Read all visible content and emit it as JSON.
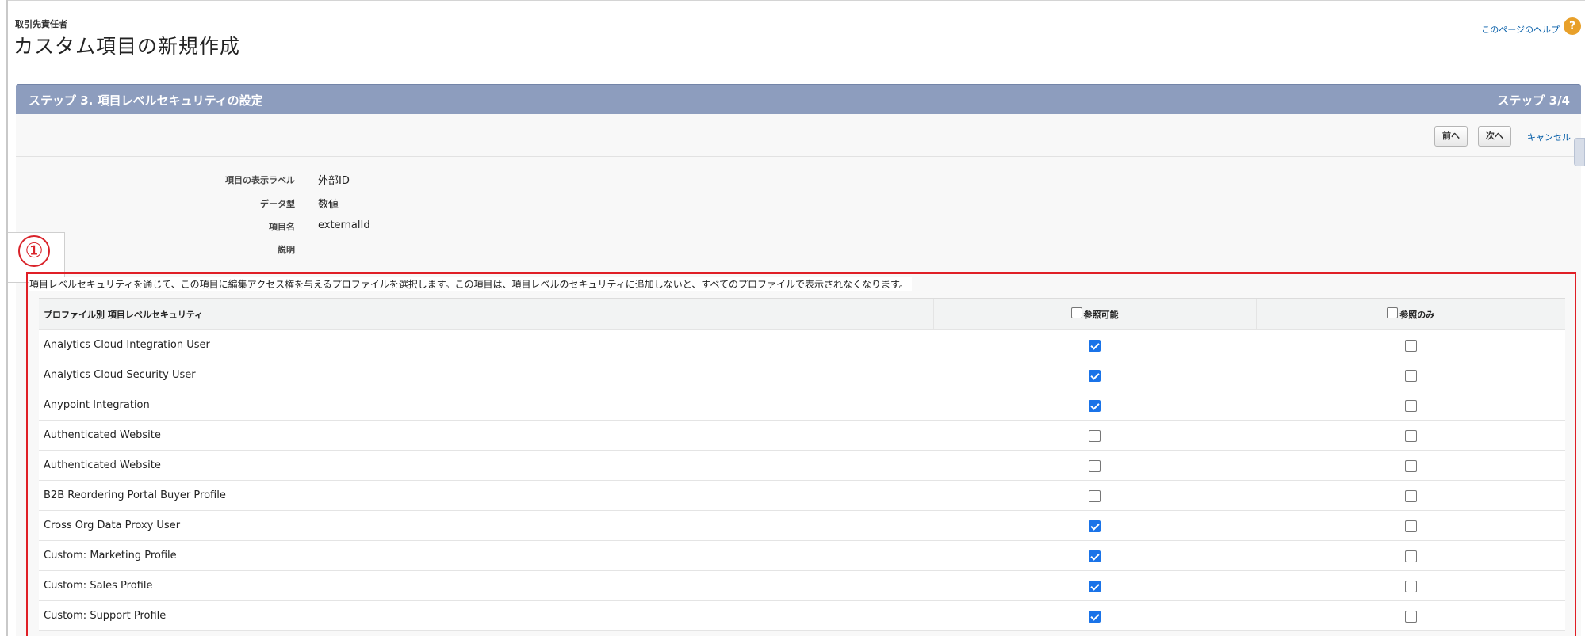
{
  "header": {
    "object_label": "取引先責任者",
    "page_title": "カスタム項目の新規作成",
    "help_link": "このページのヘルプ",
    "help_icon": "?"
  },
  "step": {
    "title": "ステップ 3. 項目レベルセキュリティの設定",
    "count": "ステップ 3/4"
  },
  "buttons": {
    "prev": "前へ",
    "next": "次へ",
    "cancel": "キャンセル"
  },
  "fields": [
    {
      "label": "項目の表示ラベル",
      "value": "外部ID"
    },
    {
      "label": "データ型",
      "value": "数値"
    },
    {
      "label": "項目名",
      "value": "externalId"
    },
    {
      "label": "説明",
      "value": ""
    }
  ],
  "callout": "①",
  "intro_text": "項目レベルセキュリティを通じて、この項目に編集アクセス権を与えるプロファイルを選択します。この項目は、項目レベルのセキュリティに追加しないと、すべてのプロファイルで表示されなくなります。",
  "table": {
    "headers": {
      "profile": "プロファイル別 項目レベルセキュリティ",
      "visible": "参照可能",
      "read_only": "参照のみ"
    },
    "rows": [
      {
        "profile": "Analytics Cloud Integration User",
        "visible": true,
        "read_only": false
      },
      {
        "profile": "Analytics Cloud Security User",
        "visible": true,
        "read_only": false
      },
      {
        "profile": "Anypoint Integration",
        "visible": true,
        "read_only": false
      },
      {
        "profile": "Authenticated Website",
        "visible": false,
        "read_only": false
      },
      {
        "profile": "Authenticated Website",
        "visible": false,
        "read_only": false
      },
      {
        "profile": "B2B Reordering Portal Buyer Profile",
        "visible": false,
        "read_only": false
      },
      {
        "profile": "Cross Org Data Proxy User",
        "visible": true,
        "read_only": false
      },
      {
        "profile": "Custom: Marketing Profile",
        "visible": true,
        "read_only": false
      },
      {
        "profile": "Custom: Sales Profile",
        "visible": true,
        "read_only": false
      },
      {
        "profile": "Custom: Support Profile",
        "visible": true,
        "read_only": false
      }
    ]
  },
  "colors": {
    "step_bar": "#8d9dbe",
    "link": "#015ba7",
    "highlight_border": "#e01f26",
    "checkbox_checked": "#1a73e8",
    "help_icon": "#e8a02a"
  }
}
